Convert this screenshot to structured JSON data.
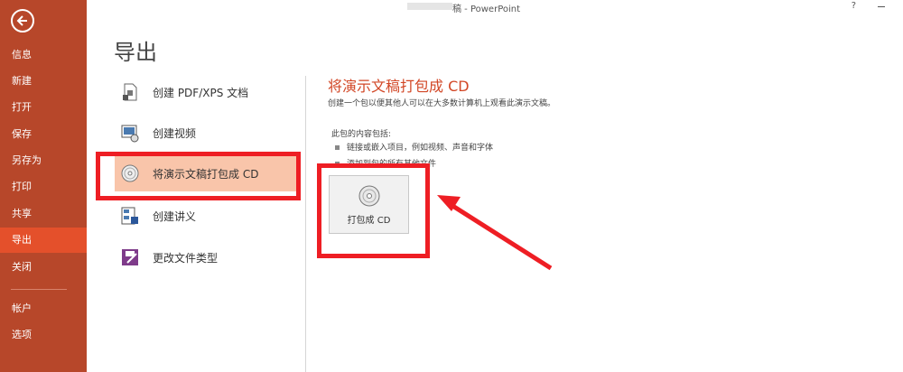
{
  "window": {
    "title_suffix": "稿 - PowerPoint",
    "help": "?"
  },
  "sidebar": {
    "items": [
      {
        "label": "信息"
      },
      {
        "label": "新建"
      },
      {
        "label": "打开"
      },
      {
        "label": "保存"
      },
      {
        "label": "另存为"
      },
      {
        "label": "打印"
      },
      {
        "label": "共享"
      },
      {
        "label": "导出"
      },
      {
        "label": "关闭"
      },
      {
        "label": "帐户"
      },
      {
        "label": "选项"
      }
    ],
    "active": "导出"
  },
  "page_title": "导出",
  "export_menu": [
    {
      "label": "创建 PDF/XPS 文档",
      "icon": "pdf-document-icon"
    },
    {
      "label": "创建视频",
      "icon": "video-icon"
    },
    {
      "label": "将演示文稿打包成 CD",
      "icon": "cd-icon"
    },
    {
      "label": "创建讲义",
      "icon": "handout-icon"
    },
    {
      "label": "更改文件类型",
      "icon": "file-type-icon"
    }
  ],
  "panel": {
    "title": "将演示文稿打包成 CD",
    "description": "创建一个包以便其他人可以在大多数计算机上观看此演示文稿。",
    "includes_label": "此包的内容包括:",
    "bullets": [
      "链接或嵌入项目，例如视频、声音和字体",
      "添加到包的所有其他文件"
    ],
    "button_label": "打包成 CD"
  },
  "colors": {
    "sidebar": "#b7472a",
    "active": "#e4502b",
    "accent": "#d24726",
    "highlight": "#ee1e24"
  }
}
